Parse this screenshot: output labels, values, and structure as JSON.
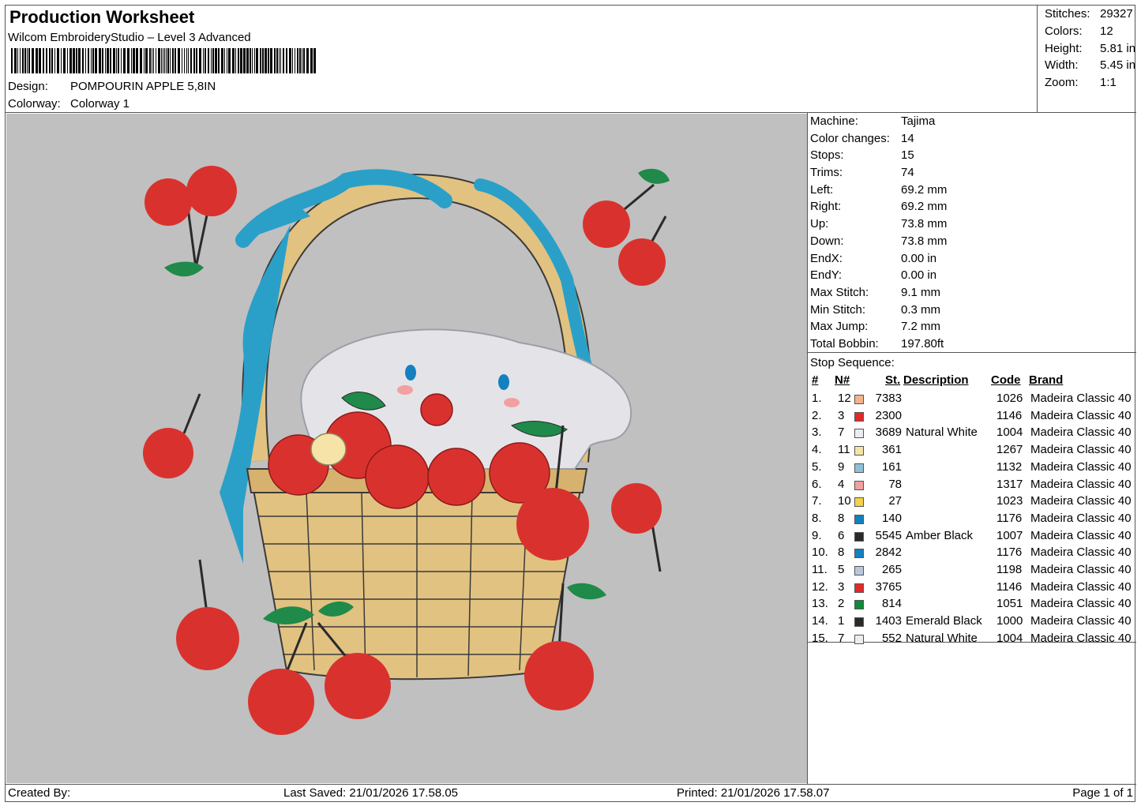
{
  "header": {
    "title": "Production Worksheet",
    "software": "Wilcom EmbroideryStudio – Level 3 Advanced",
    "design_label": "Design:",
    "design_value": "POMPOURIN APPLE 5,8IN",
    "colorway_label": "Colorway:",
    "colorway_value": "Colorway 1"
  },
  "summary": [
    {
      "label": "Stitches:",
      "value": "29327"
    },
    {
      "label": "Colors:",
      "value": "12"
    },
    {
      "label": "Height:",
      "value": "5.81 in"
    },
    {
      "label": "Width:",
      "value": "5.45 in"
    },
    {
      "label": "Zoom:",
      "value": "1:1"
    }
  ],
  "machine": [
    {
      "label": "Machine:",
      "value": "Tajima"
    },
    {
      "label": "Color changes:",
      "value": "14"
    },
    {
      "label": "Stops:",
      "value": "15"
    },
    {
      "label": "Trims:",
      "value": "74"
    },
    {
      "label": "Left:",
      "value": "69.2 mm"
    },
    {
      "label": "Right:",
      "value": "69.2 mm"
    },
    {
      "label": "Up:",
      "value": "73.8 mm"
    },
    {
      "label": "Down:",
      "value": "73.8 mm"
    },
    {
      "label": "EndX:",
      "value": "0.00 in"
    },
    {
      "label": "EndY:",
      "value": "0.00 in"
    },
    {
      "label": "Max Stitch:",
      "value": "9.1 mm"
    },
    {
      "label": "Min Stitch:",
      "value": "0.3 mm"
    },
    {
      "label": "Max Jump:",
      "value": "7.2 mm"
    },
    {
      "label": "Total Bobbin:",
      "value": "197.80ft"
    }
  ],
  "stop_sequence": {
    "caption": "Stop Sequence:",
    "headers": {
      "idx": "#",
      "n": "N#",
      "st": "St.",
      "desc": "Description",
      "code": "Code",
      "brand": "Brand"
    },
    "rows": [
      {
        "idx": "1.",
        "n": "12",
        "color": "#f2b48c",
        "st": "7383",
        "desc": "",
        "code": "1026",
        "brand": "Madeira Classic 40"
      },
      {
        "idx": "2.",
        "n": "3",
        "color": "#e02a2a",
        "st": "2300",
        "desc": "",
        "code": "1146",
        "brand": "Madeira Classic 40"
      },
      {
        "idx": "3.",
        "n": "7",
        "color": "#ececf2",
        "st": "3689",
        "desc": "Natural White",
        "code": "1004",
        "brand": "Madeira Classic 40"
      },
      {
        "idx": "4.",
        "n": "11",
        "color": "#f6e3a8",
        "st": "361",
        "desc": "",
        "code": "1267",
        "brand": "Madeira Classic 40"
      },
      {
        "idx": "5.",
        "n": "9",
        "color": "#8fc0d8",
        "st": "161",
        "desc": "",
        "code": "1132",
        "brand": "Madeira Classic 40"
      },
      {
        "idx": "6.",
        "n": "4",
        "color": "#f2a0a0",
        "st": "78",
        "desc": "",
        "code": "1317",
        "brand": "Madeira Classic 40"
      },
      {
        "idx": "7.",
        "n": "10",
        "color": "#f2d24a",
        "st": "27",
        "desc": "",
        "code": "1023",
        "brand": "Madeira Classic 40"
      },
      {
        "idx": "8.",
        "n": "8",
        "color": "#1480c0",
        "st": "140",
        "desc": "",
        "code": "1176",
        "brand": "Madeira Classic 40"
      },
      {
        "idx": "9.",
        "n": "6",
        "color": "#2a2a2a",
        "st": "5545",
        "desc": "Amber Black",
        "code": "1007",
        "brand": "Madeira Classic 40"
      },
      {
        "idx": "10.",
        "n": "8",
        "color": "#1480c0",
        "st": "2842",
        "desc": "",
        "code": "1176",
        "brand": "Madeira Classic 40"
      },
      {
        "idx": "11.",
        "n": "5",
        "color": "#b8c8dc",
        "st": "265",
        "desc": "",
        "code": "1198",
        "brand": "Madeira Classic 40"
      },
      {
        "idx": "12.",
        "n": "3",
        "color": "#e02a2a",
        "st": "3765",
        "desc": "",
        "code": "1146",
        "brand": "Madeira Classic 40"
      },
      {
        "idx": "13.",
        "n": "2",
        "color": "#0e8a3a",
        "st": "814",
        "desc": "",
        "code": "1051",
        "brand": "Madeira Classic 40"
      },
      {
        "idx": "14.",
        "n": "1",
        "color": "#2a2a2a",
        "st": "1403",
        "desc": "Emerald Black",
        "code": "1000",
        "brand": "Madeira Classic 40"
      },
      {
        "idx": "15.",
        "n": "7",
        "color": "#ececf2",
        "st": "552",
        "desc": "Natural White",
        "code": "1004",
        "brand": "Madeira Classic 40"
      }
    ]
  },
  "footer": {
    "created_by": "Created By:",
    "last_saved": "Last Saved: 21/01/2026 17.58.05",
    "printed": "Printed: 21/01/2026 17.58.07",
    "page": "Page 1 of 1"
  },
  "colors": {
    "preview_bg": "#c0c0c0",
    "basket": "#e2c281",
    "ribbon": "#2aa0c8",
    "cherry": "#d9322e",
    "leaf": "#1f8a4a",
    "stem": "#2a2a2a",
    "bunny": "#e4e4e8"
  }
}
